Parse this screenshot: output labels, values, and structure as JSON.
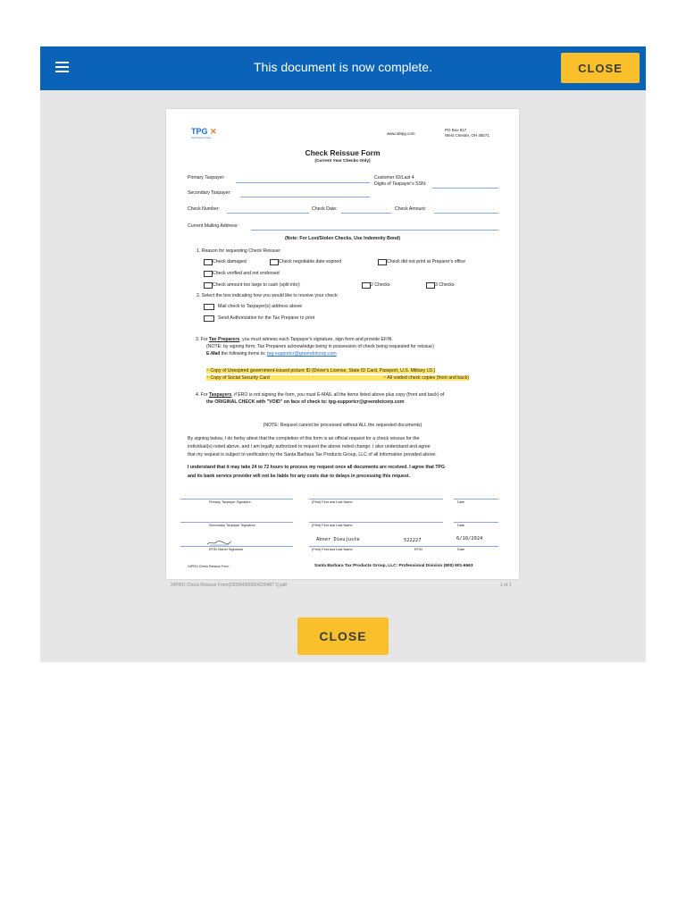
{
  "header": {
    "message": "This document is now complete.",
    "close_label": "CLOSE",
    "bar_color": "#0a63b8",
    "button_color": "#f9c02c"
  },
  "document": {
    "logo_text": "TPG",
    "logo_tagline": "Tax Products Group",
    "website": "www.sbtpg.com",
    "po_box": "PO Box 817",
    "city": "West Chester, OH 45071",
    "title": "Check Reissue Form",
    "subtitle": "(Current Year Checks Only)",
    "fields": {
      "primary_taxpayer": "Primary Taxpayer:",
      "customer_id_1": "Customer ID/Last 4",
      "customer_id_2": "Digits of Taxpayer's SSN:",
      "secondary_taxpayer": "Secondary Taxpayer:",
      "check_number": "Check Number:",
      "check_date": "Check Date:",
      "check_amount": "Check Amount:",
      "mailing_address": "Current Mailing Address:"
    },
    "note_lost": "(Note: For Lost/Stolen Checks, Use Indemnity Bond)",
    "section1_heading": "1.    Reason for requesting Check Reissue:",
    "reasons": {
      "damaged": "Check damaged",
      "negotiable": "Check negotiable date expired",
      "not_printed": "Check did not print at Preparer's office",
      "not_endorsed": "Check verified and not endorsed",
      "too_large": "Check amount too large to cash (split into):",
      "two_checks": "2 Checks",
      "three_checks": "3 Checks"
    },
    "section2_heading": "2.    Select the box indicating how you would like to receive your check:",
    "receive": {
      "mail": "Mail check to Taxpayer(s) address above",
      "send_auth": "Send Authorization for the Tax Preparer to print"
    },
    "section3": {
      "prefix": "3.    For ",
      "link_word": "Tax Preparers",
      "rest": ", you must witness each Taxpayer's signature, sign form and provide EFIN.",
      "note": "(NOTE: by signing form, Tax Preparers acknowledge being in possession of check being requested for reissue)",
      "email_label": "E-Mail",
      "email_text": " the following items to: ",
      "email": "tpg-supportcr@greendotcorp.com",
      "item1": "~ Copy of Unexpired government-issued picture ID (Driver's License, State ID Card, Passport, U.S. Military I.D.)",
      "item2": "~ Copy of Social Security Card",
      "item3": "~ All voided check copies (front and back)"
    },
    "section4": {
      "line1_prefix": "4.    For ",
      "line1_word": "Taxpayers",
      "line1_rest": ", if ERO is not signing the form, you must E-MAIL all the items listed above plus copy (front and back) of",
      "line2": "the ORIGINAL CHECK with \"VOID\" on face of check to: tpg-supportcr@greendotcorp.com"
    },
    "note_all": "(NOTE: Request cannot be processed without ALL the requested documents)",
    "attest_lines": [
      "By signing below, I do herby attest that the completion of this form is an official request for a check reissue for the",
      "individual(s) noted above, and I am legally authorized to request the above noted change. I also understand and agree",
      "that my request is subject to verification by the Santa Barbara Tax Products Group, LLC of all information provided above."
    ],
    "understand_lines": [
      "I understand that it may take 24 to 72 hours to process my request once all documents are received. I agree that TPG",
      "and its bank service provider will not be liable for any costs due to delays in processing this request."
    ],
    "sig_labels": {
      "primary": "Primary Taxpayer Signature",
      "print1": "(Print) First and Last Name",
      "date1": "Date",
      "secondary": "Secondary Taxpayer Signature",
      "print2": "(Print) First and Last Name",
      "date2": "Date",
      "efin_owner": "EFIN Owner Signature",
      "print3": "(Print) First and Last Name",
      "efin": "EFIN",
      "date3": "Date"
    },
    "filled": {
      "name": "Abner Dieujuste",
      "efin": "522227",
      "date": "6/10/2024"
    },
    "footer_left": "24PRO Check Reissue Form",
    "footer_right": "Santa Barbara Tax Products Group, LLC: Professional Division (800) 901-6663"
  },
  "viewer": {
    "filename": "24PRO Check Reissue Form[230584300934220487 1].pdf",
    "page_indicator": "1 of 1"
  },
  "footer": {
    "close_label": "CLOSE"
  }
}
